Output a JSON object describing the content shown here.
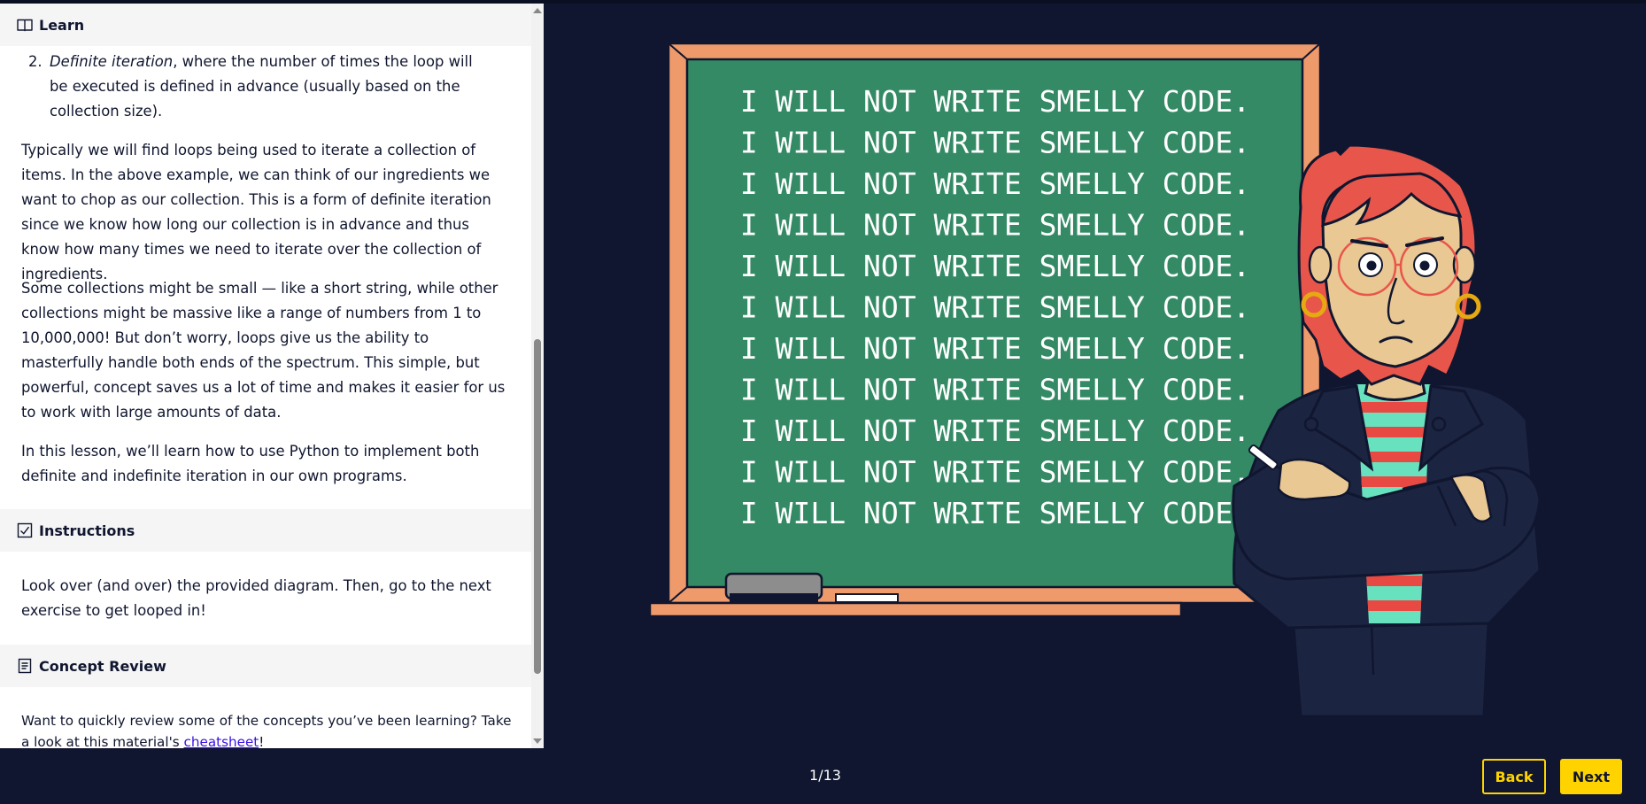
{
  "learn": {
    "header": "Learn",
    "list_item_2": {
      "number": "2.",
      "term": "Definite iteration",
      "rest": ", where the number of times the loop will be executed is defined in advance (usually based on the collection size)."
    },
    "paragraph_1": "Typically we will find loops being used to iterate a collection of items. In the above example, we can think of our ingredients we want to chop as our collection. This is a form of definite iteration since we know how long our collection is in advance and thus know how many times we need to iterate over the collection of ingredients.",
    "paragraph_2": "Some collections might be small — like a short string, while other collections might be massive like a range of numbers from 1 to 10,000,000! But don’t worry, loops give us the ability to masterfully handle both ends of the spectrum. This simple, but powerful, concept saves us a lot of time and makes it easier for us to work with large amounts of data.",
    "paragraph_3": "In this lesson, we’ll learn how to use Python to implement both definite and indefinite iteration in our own programs."
  },
  "instructions": {
    "header": "Instructions",
    "text": "Look over (and over) the provided diagram. Then, go to the next exercise to get looped in!"
  },
  "concept_review": {
    "header": "Concept Review",
    "text_before": "Want to quickly review some of the concepts you’ve been learning? Take a look at this material's ",
    "link": "cheatsheet",
    "text_after": "!"
  },
  "chalkboard": {
    "lines": [
      "I WILL NOT WRITE SMELLY CODE.",
      "I WILL NOT WRITE SMELLY CODE.",
      "I WILL NOT WRITE SMELLY CODE.",
      "I WILL NOT WRITE SMELLY CODE.",
      "I WILL NOT WRITE SMELLY CODE.",
      "I WILL NOT WRITE SMELLY CODE.",
      "I WILL NOT WRITE SMELLY CODE.",
      "I WILL NOT WRITE SMELLY CODE.",
      "I WILL NOT WRITE SMELLY CODE.",
      "I WILL NOT WRITE SMELLY CODE.",
      "I WILL NOT WRITE SMELLY CODE."
    ]
  },
  "footer": {
    "page_indicator": "1/13",
    "back_label": "Back",
    "next_label": "Next"
  },
  "colors": {
    "background": "#10162f",
    "accent": "#ffd300",
    "board_green": "#348a65",
    "board_frame": "#ef9a6b",
    "hair": "#e8564b",
    "link": "#3a10e5"
  },
  "icons": [
    "book-icon",
    "checkbox-icon",
    "document-icon"
  ]
}
